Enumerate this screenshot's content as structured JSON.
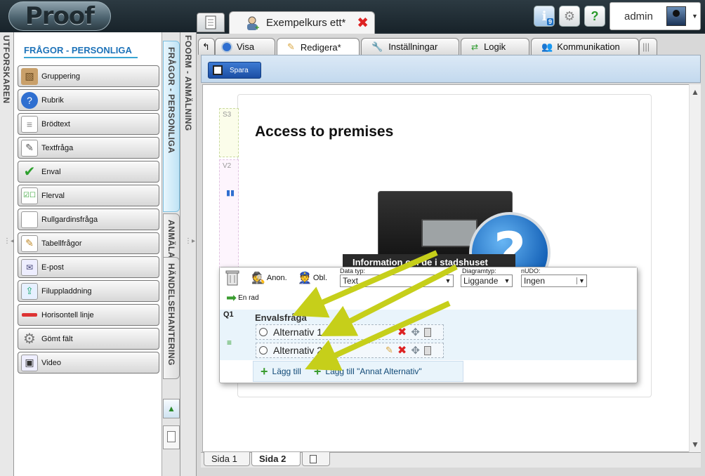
{
  "app": {
    "logo_text": "Proof"
  },
  "topbar": {
    "notification_count": "9",
    "help_label": "?",
    "user_name": "admin"
  },
  "doc_tab": {
    "label": "Exempelkurs ett*"
  },
  "left_strip": {
    "label": "UTFORSKAREN"
  },
  "panel": {
    "title": "FRÅGOR - PERSONLIGA",
    "tools": [
      {
        "label": "Gruppering",
        "icon": "grouping-icon"
      },
      {
        "label": "Rubrik",
        "icon": "heading-icon"
      },
      {
        "label": "Brödtext",
        "icon": "body-text-icon"
      },
      {
        "label": "Textfråga",
        "icon": "text-question-icon"
      },
      {
        "label": "Enval",
        "icon": "checkmark-icon"
      },
      {
        "label": "Flerval",
        "icon": "multi-choice-icon"
      },
      {
        "label": "Rullgardinsfråga",
        "icon": "dropdown-icon"
      },
      {
        "label": "Tabellfrågor",
        "icon": "table-icon"
      },
      {
        "label": "E-post",
        "icon": "email-icon"
      },
      {
        "label": "Filuppladdning",
        "icon": "upload-icon"
      },
      {
        "label": "Horisontell linje",
        "icon": "horizontal-line-icon"
      },
      {
        "label": "Gömt fält",
        "icon": "gear-icon"
      },
      {
        "label": "Video",
        "icon": "video-icon"
      }
    ]
  },
  "vtabs": {
    "tab1": "FRÅGOR - PERSONLIGA",
    "tab2": "ANMÄLAN",
    "tab3": "HÄNDELSEHANTERING"
  },
  "strip2": {
    "label": "FOORM - ANMÄLNING"
  },
  "main_tabs": [
    {
      "label": "Visa"
    },
    {
      "label": "Redigera*"
    },
    {
      "label": "Inställningar"
    },
    {
      "label": "Logik"
    },
    {
      "label": "Kommunikation"
    }
  ],
  "toolbar": {
    "save_label": "Spara"
  },
  "page": {
    "s3_label": "S3",
    "v2_label": "V2",
    "title": "Access to premises",
    "info_band": "Information om de i stadshuset"
  },
  "editor": {
    "anon_label": "Anon.",
    "obl_label": "Obl.",
    "datatype_label": "Data typ:",
    "datatype_value": "Text",
    "diagramtype_label": "Diagramtyp:",
    "diagramtype_value": "Liggande",
    "nudo_label": "nUDO:",
    "nudo_value": "Ingen",
    "en_rad_label": "En rad",
    "question_id": "Q1",
    "question_title": "Envalsfråga",
    "alternatives": [
      "Alternativ 1",
      "Alternativ 2"
    ],
    "add_label": "Lägg till",
    "add_other_label": "Lägg till \"Annat Alternativ\""
  },
  "page_tabs": [
    {
      "label": "Sida 1"
    },
    {
      "label": "Sida 2"
    }
  ],
  "colors": {
    "accent": "#1e73b9",
    "arrow": "#c6cf1a",
    "delete": "#dd2222"
  }
}
